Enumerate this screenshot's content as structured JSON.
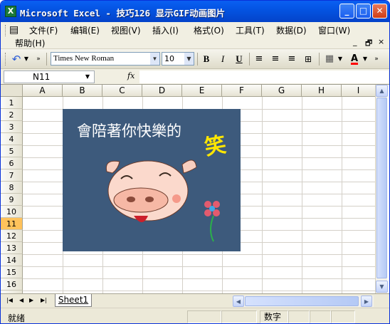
{
  "window": {
    "title": "Microsoft Excel - 技巧126 显示GIF动画图片",
    "app_icon_letter": "X",
    "minimize": "_",
    "maximize": "□",
    "close": "✕"
  },
  "menu": {
    "items": [
      "文件(F)",
      "编辑(E)",
      "视图(V)",
      "插入(I)",
      "格式(O)",
      "工具(T)",
      "数据(D)",
      "窗口(W)",
      "帮助(H)"
    ],
    "mdi_min": "_",
    "mdi_restore": "🗗",
    "mdi_close": "×"
  },
  "toolbar": {
    "font_name": "Times New Roman",
    "font_size": "10",
    "bold": "B",
    "italic": "I",
    "underline": "U",
    "font_color_label": "A",
    "font_color": "#ff0000"
  },
  "formula_bar": {
    "name_box": "N11",
    "fx_label": "fx",
    "formula": ""
  },
  "grid": {
    "columns": [
      "A",
      "B",
      "C",
      "D",
      "E",
      "F",
      "G",
      "H",
      "I"
    ],
    "rows": [
      "1",
      "2",
      "3",
      "4",
      "5",
      "6",
      "7",
      "8",
      "9",
      "10",
      "11",
      "12",
      "13",
      "14",
      "15",
      "16",
      "17"
    ],
    "active_row": "11"
  },
  "picture": {
    "caption": "會陪著你快樂的",
    "accent_char": "笑",
    "background": "#3d5a7c"
  },
  "sheets": {
    "tabs": [
      "Sheet1"
    ]
  },
  "status": {
    "ready": "就绪",
    "mode": "数字"
  }
}
